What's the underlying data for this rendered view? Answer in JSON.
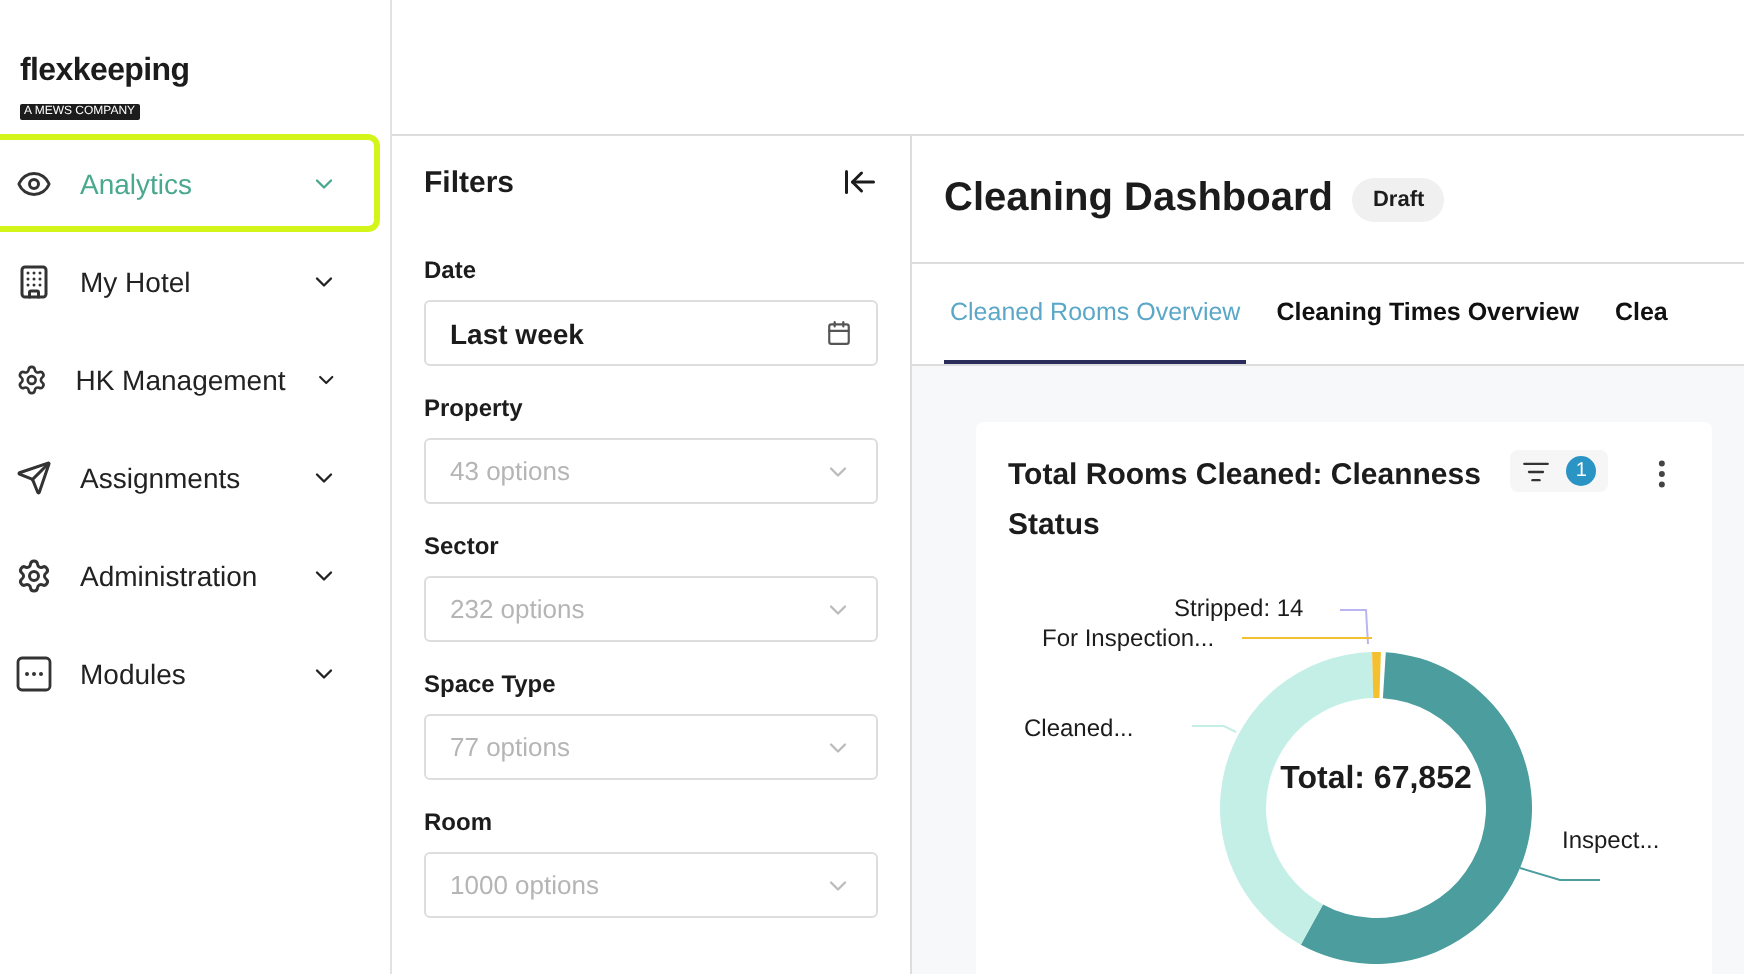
{
  "logo": {
    "name": "flexkeeping",
    "tagline": "A MEWS COMPANY"
  },
  "sidebar": {
    "items": [
      {
        "label": "Analytics",
        "selected": true
      },
      {
        "label": "My Hotel",
        "selected": false
      },
      {
        "label": "HK Management",
        "selected": false
      },
      {
        "label": "Assignments",
        "selected": false
      },
      {
        "label": "Administration",
        "selected": false
      },
      {
        "label": "Modules",
        "selected": false
      }
    ]
  },
  "filters": {
    "title": "Filters",
    "fields": [
      {
        "label": "Date",
        "kind": "date",
        "value": "Last week"
      },
      {
        "label": "Property",
        "kind": "select",
        "placeholder": "43 options"
      },
      {
        "label": "Sector",
        "kind": "select",
        "placeholder": "232 options"
      },
      {
        "label": "Space Type",
        "kind": "select",
        "placeholder": "77 options"
      },
      {
        "label": "Room",
        "kind": "select",
        "placeholder": "1000 options"
      }
    ]
  },
  "dashboard": {
    "title": "Cleaning Dashboard",
    "badge": "Draft",
    "tabs": [
      {
        "label": "Cleaned Rooms Overview",
        "selected": true
      },
      {
        "label": "Cleaning Times Overview",
        "selected": false
      },
      {
        "label": "Clea",
        "selected": false
      }
    ],
    "card": {
      "title": "Total Rooms Cleaned: Cleanness Status",
      "filter_count": "1",
      "total": "Total: 67,852",
      "labels": [
        "Stripped: 14",
        "For Inspection...",
        "Cleaned...",
        "Inspect..."
      ]
    }
  }
}
